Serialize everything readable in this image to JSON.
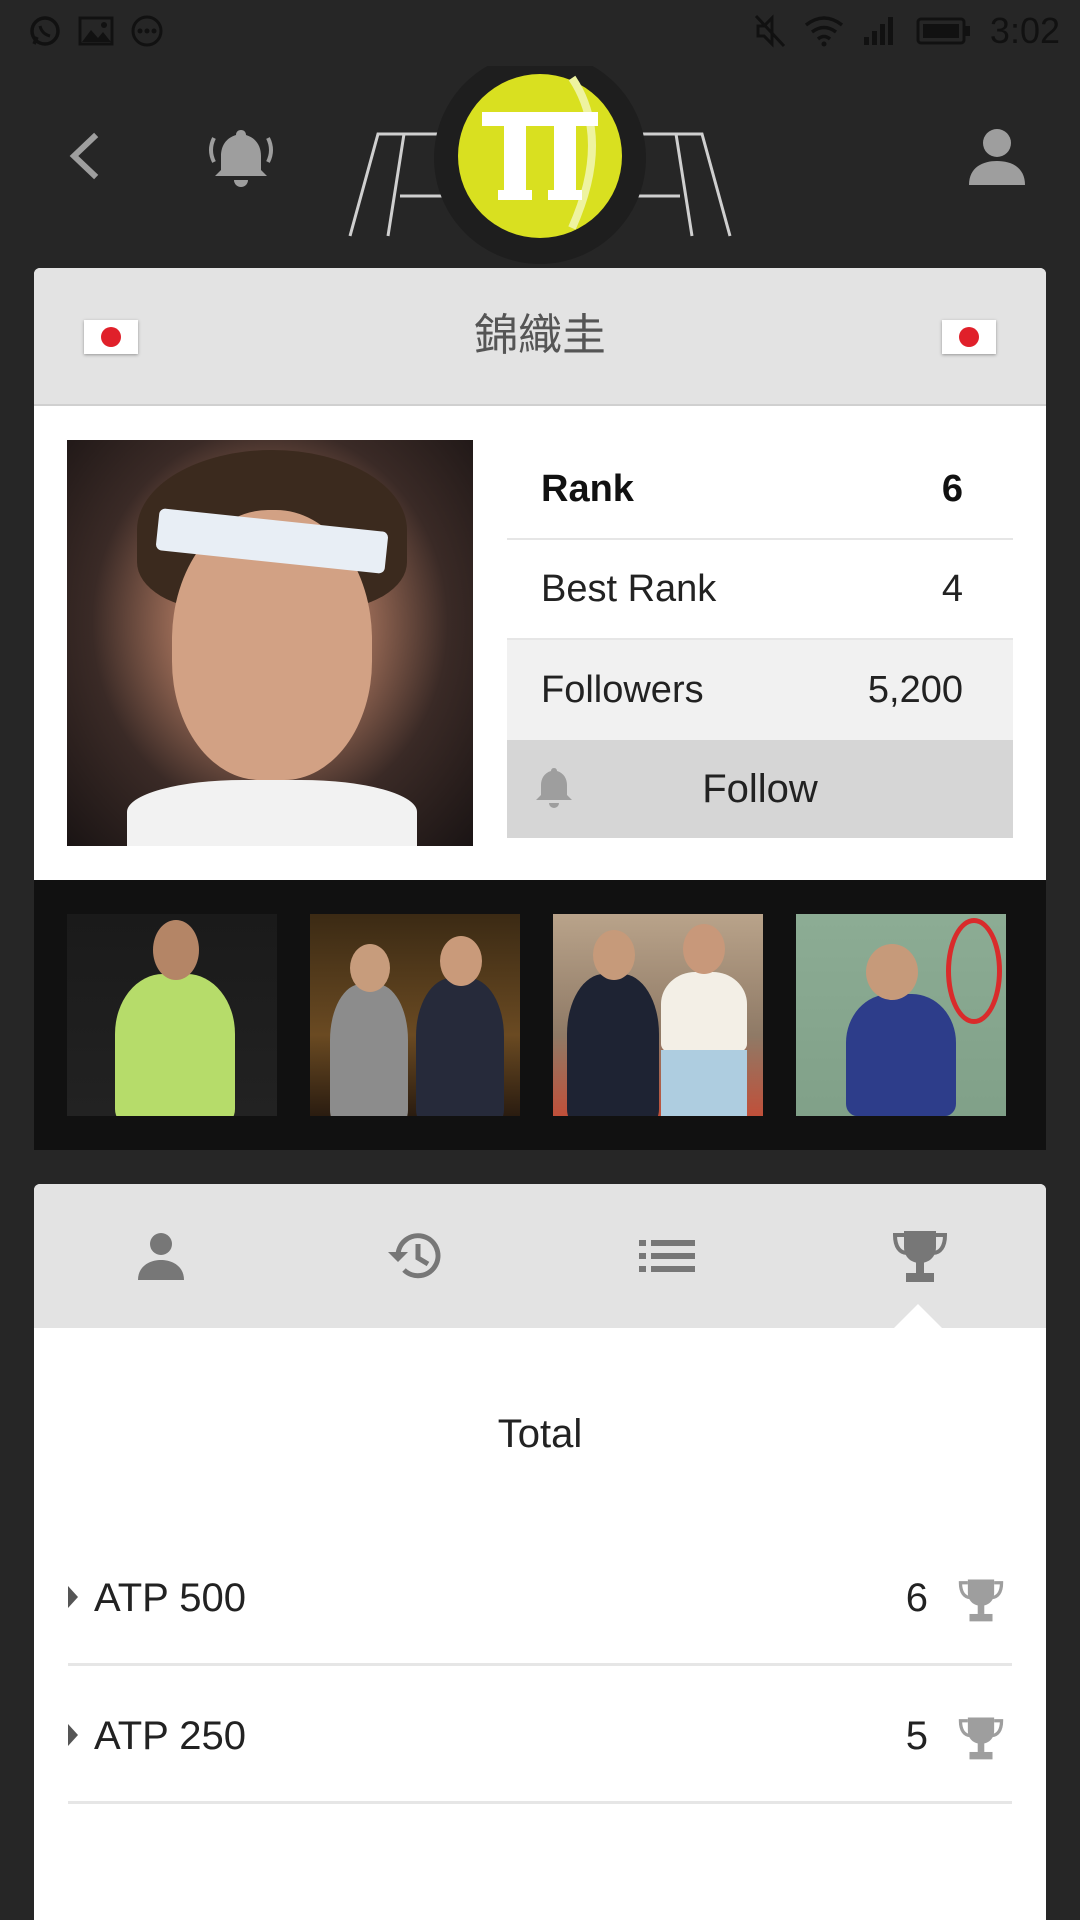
{
  "status_bar": {
    "time": "3:02",
    "left_icons": [
      "whatsapp-icon",
      "image-icon",
      "more-icon"
    ],
    "right_icons": [
      "mute-icon",
      "wifi-icon",
      "signal-icon",
      "battery-icon"
    ]
  },
  "top_nav": {
    "back_icon": "back-icon",
    "bell_icon": "bell-icon",
    "profile_icon": "person-icon",
    "logo_text": "TT"
  },
  "player": {
    "name": "錦織圭",
    "flag_left": "japan-flag",
    "flag_right": "japan-flag",
    "stats": [
      {
        "label": "Rank",
        "value": "6"
      },
      {
        "label": "Best Rank",
        "value": "4"
      },
      {
        "label": "Followers",
        "value": "5,200"
      }
    ],
    "follow_label": "Follow"
  },
  "gallery": {
    "thumbnails": [
      "photo-1",
      "photo-2",
      "photo-3",
      "photo-4"
    ]
  },
  "tabs": [
    {
      "icon": "person-icon"
    },
    {
      "icon": "history-icon"
    },
    {
      "icon": "list-icon"
    },
    {
      "icon": "trophy-icon",
      "active": true
    }
  ],
  "titles": {
    "section_title": "Total"
  },
  "trophy_rows": [
    {
      "label": "ATP 500",
      "count": "6"
    },
    {
      "label": "ATP 250",
      "count": "5"
    }
  ],
  "colors": {
    "background": "#262626",
    "logo_yellow": "#d9e020",
    "header_gray": "#e3e3e3",
    "follow_gray": "#d6d6d6",
    "flag_red": "#e0202a"
  }
}
